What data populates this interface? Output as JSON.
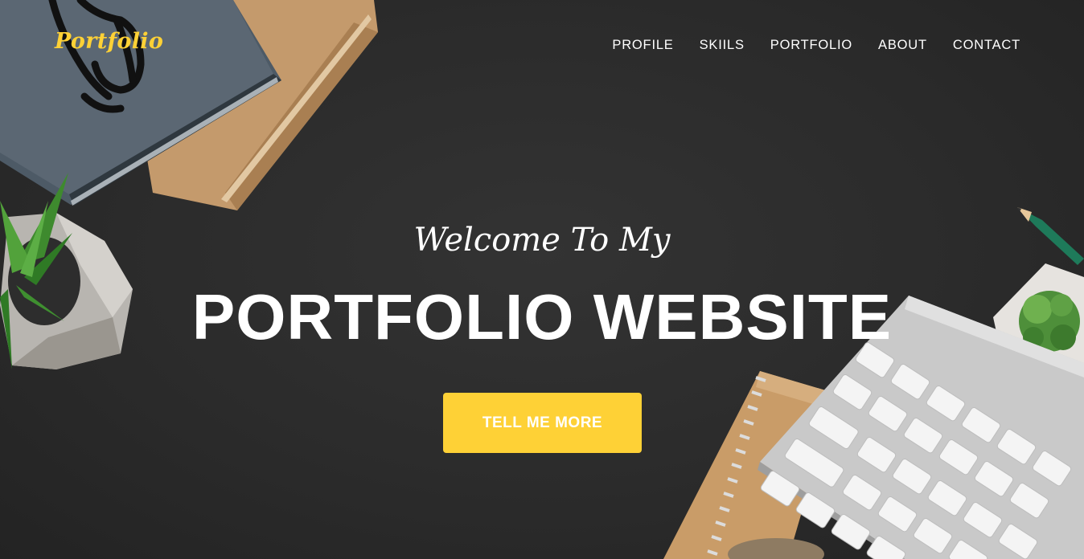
{
  "brand": {
    "logo_text": "Portfolio",
    "accent_color": "#fed136"
  },
  "nav": {
    "items": [
      {
        "label": "PROFILE"
      },
      {
        "label": "SKIILS"
      },
      {
        "label": "PORTFOLIO"
      },
      {
        "label": "ABOUT"
      },
      {
        "label": "CONTACT"
      }
    ]
  },
  "hero": {
    "subheading": "Welcome To My",
    "heading": "PORTFOLIO WEBSITE",
    "cta_label": "TELL ME MORE",
    "background_color": "#2b2b2b"
  },
  "decor": {
    "icons": [
      "notebook-stack-image",
      "eyeglasses-image",
      "succulent-plant-image",
      "pencil-image",
      "spiral-notebook-image",
      "keyboard-image"
    ]
  }
}
